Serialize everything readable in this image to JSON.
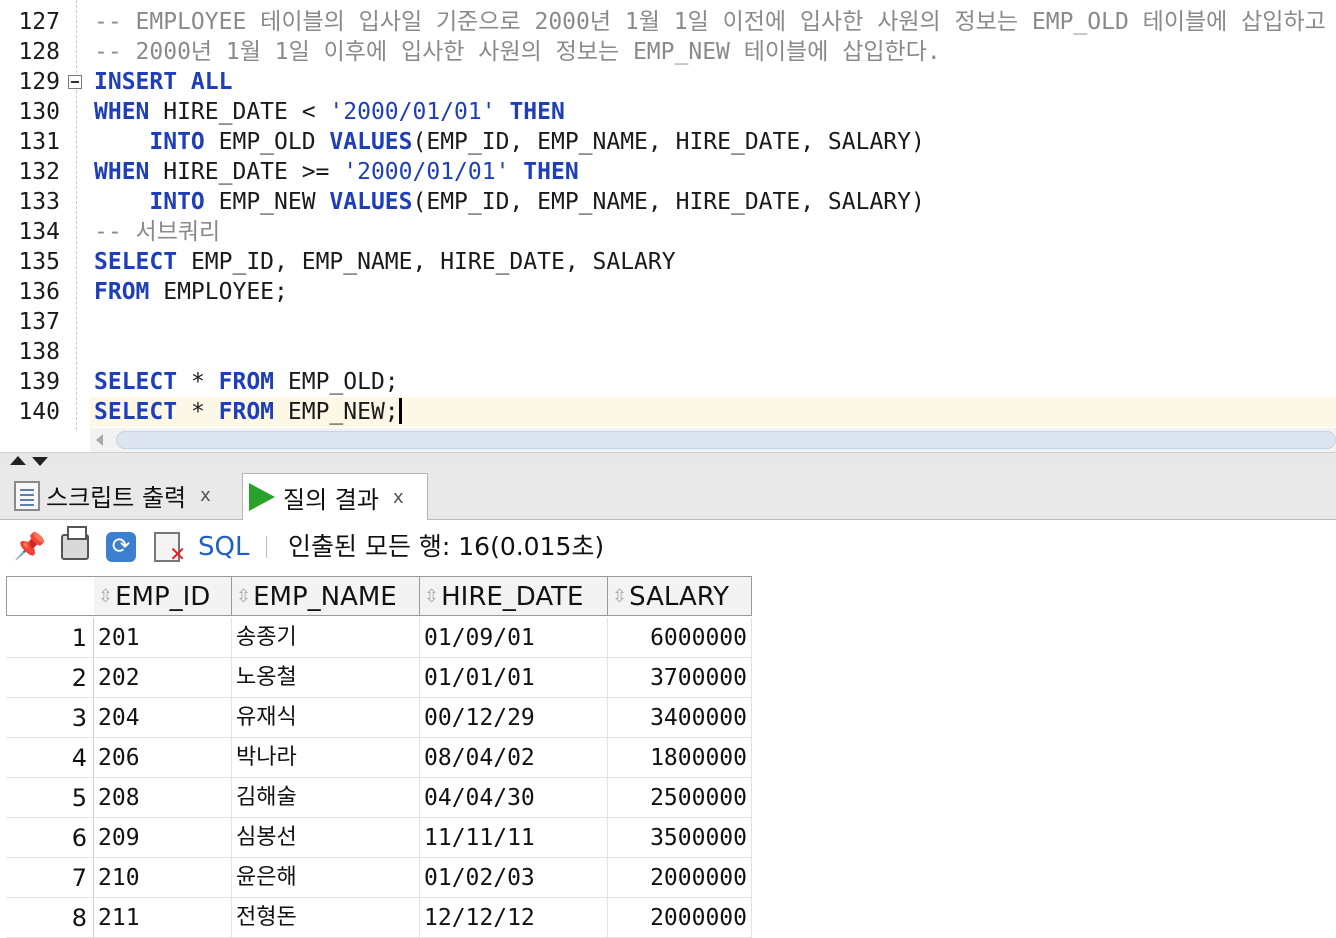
{
  "editor": {
    "lines": [
      {
        "num": "127",
        "parts": [
          {
            "t": "-- EMPLOYEE 테이블의 입사일 기준으로 2000년 1월 1일 이전에 입사한 사원의 정보는 EMP_OLD 테이블에 삽입하고",
            "c": "cmt"
          }
        ]
      },
      {
        "num": "128",
        "parts": [
          {
            "t": "-- 2000년 1월 1일 이후에 입사한 사원의 정보는 EMP_NEW 테이블에 삽입한다.",
            "c": "cmt"
          }
        ]
      },
      {
        "num": "129",
        "fold": true,
        "parts": [
          {
            "t": "INSERT ALL",
            "c": "kw"
          }
        ]
      },
      {
        "num": "130",
        "parts": [
          {
            "t": "WHEN",
            "c": "kw"
          },
          {
            "t": " HIRE_DATE < ",
            "c": ""
          },
          {
            "t": "'2000/01/01'",
            "c": "str"
          },
          {
            "t": " ",
            "c": ""
          },
          {
            "t": "THEN",
            "c": "kw"
          }
        ]
      },
      {
        "num": "131",
        "parts": [
          {
            "t": "    ",
            "c": ""
          },
          {
            "t": "INTO",
            "c": "kw"
          },
          {
            "t": " EMP_OLD ",
            "c": ""
          },
          {
            "t": "VALUES",
            "c": "kw"
          },
          {
            "t": "(EMP_ID, EMP_NAME, HIRE_DATE, SALARY)",
            "c": ""
          }
        ]
      },
      {
        "num": "132",
        "parts": [
          {
            "t": "WHEN",
            "c": "kw"
          },
          {
            "t": " HIRE_DATE >= ",
            "c": ""
          },
          {
            "t": "'2000/01/01'",
            "c": "str"
          },
          {
            "t": " ",
            "c": ""
          },
          {
            "t": "THEN",
            "c": "kw"
          }
        ]
      },
      {
        "num": "133",
        "parts": [
          {
            "t": "    ",
            "c": ""
          },
          {
            "t": "INTO",
            "c": "kw"
          },
          {
            "t": " EMP_NEW ",
            "c": ""
          },
          {
            "t": "VALUES",
            "c": "kw"
          },
          {
            "t": "(EMP_ID, EMP_NAME, HIRE_DATE, SALARY)",
            "c": ""
          }
        ]
      },
      {
        "num": "134",
        "parts": [
          {
            "t": "-- 서브쿼리",
            "c": "cmt"
          }
        ]
      },
      {
        "num": "135",
        "parts": [
          {
            "t": "SELECT",
            "c": "kw"
          },
          {
            "t": " EMP_ID, EMP_NAME, HIRE_DATE, SALARY",
            "c": ""
          }
        ]
      },
      {
        "num": "136",
        "parts": [
          {
            "t": "FROM",
            "c": "kw"
          },
          {
            "t": " EMPLOYEE;",
            "c": ""
          }
        ]
      },
      {
        "num": "137",
        "parts": []
      },
      {
        "num": "138",
        "parts": []
      },
      {
        "num": "139",
        "parts": [
          {
            "t": "SELECT",
            "c": "kw"
          },
          {
            "t": " * ",
            "c": ""
          },
          {
            "t": "FROM",
            "c": "kw"
          },
          {
            "t": " EMP_OLD;",
            "c": ""
          }
        ]
      },
      {
        "num": "140",
        "current": true,
        "parts": [
          {
            "t": "SELECT",
            "c": "kw"
          },
          {
            "t": " * ",
            "c": ""
          },
          {
            "t": "FROM",
            "c": "kw"
          },
          {
            "t": " EMP_NEW;",
            "c": ""
          }
        ]
      }
    ]
  },
  "tabs": {
    "script_output": "스크립트 출력",
    "query_result": "질의 결과",
    "close_glyph": "x"
  },
  "toolbar": {
    "pin_icon": "pin-icon",
    "print_icon": "print-icon",
    "refresh_icon": "refresh-icon",
    "clear_icon": "clear-icon",
    "sql_label": "SQL",
    "status": "인출된 모든 행: 16(0.015초)"
  },
  "grid": {
    "columns": [
      "EMP_ID",
      "EMP_NAME",
      "HIRE_DATE",
      "SALARY"
    ],
    "rows": [
      {
        "n": "1",
        "id": "201",
        "name": "송종기",
        "date": "01/09/01",
        "salary": "6000000"
      },
      {
        "n": "2",
        "id": "202",
        "name": "노옹철",
        "date": "01/01/01",
        "salary": "3700000"
      },
      {
        "n": "3",
        "id": "204",
        "name": "유재식",
        "date": "00/12/29",
        "salary": "3400000"
      },
      {
        "n": "4",
        "id": "206",
        "name": "박나라",
        "date": "08/04/02",
        "salary": "1800000"
      },
      {
        "n": "5",
        "id": "208",
        "name": "김해술",
        "date": "04/04/30",
        "salary": "2500000"
      },
      {
        "n": "6",
        "id": "209",
        "name": "심봉선",
        "date": "11/11/11",
        "salary": "3500000"
      },
      {
        "n": "7",
        "id": "210",
        "name": "윤은해",
        "date": "01/02/03",
        "salary": "2000000"
      },
      {
        "n": "8",
        "id": "211",
        "name": "전형돈",
        "date": "12/12/12",
        "salary": "2000000"
      }
    ]
  },
  "colors": {
    "keyword": "#1f3fb8",
    "comment": "#8a8a8a",
    "current_line": "#fdf8e6",
    "run_green": "#2aa12a"
  }
}
